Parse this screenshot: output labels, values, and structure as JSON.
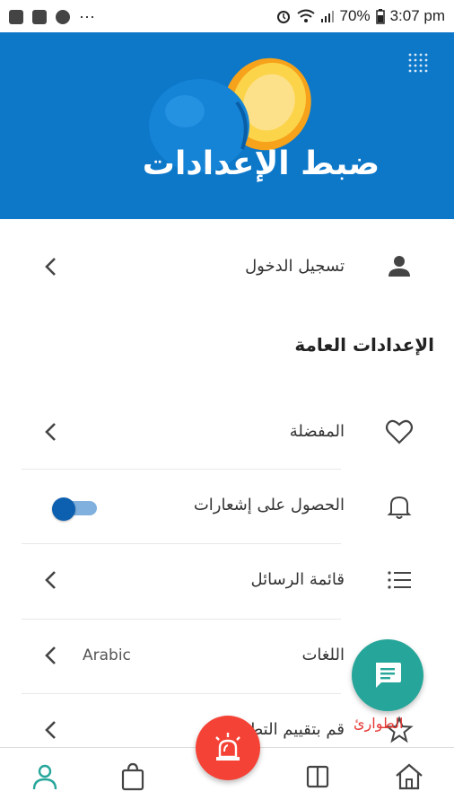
{
  "status_bar": {
    "battery": "70%",
    "time": "3:07 pm",
    "notif_dots": "···"
  },
  "header": {
    "title": "ضبط الإعدادات"
  },
  "login_row": {
    "label": "تسجيل الدخول"
  },
  "general_settings": {
    "title": "الإعدادات العامة",
    "items": [
      {
        "label": "المفضلة"
      },
      {
        "label": "الحصول على إشعارات",
        "toggle_on": true
      },
      {
        "label": "قائمة الرسائل"
      },
      {
        "label": "اللغات",
        "value": "Arabic"
      },
      {
        "label": "قم بتقييم التطبيق"
      }
    ]
  },
  "emergency_label": "الطوارئ",
  "colors": {
    "hero_blue": "#0d77c8",
    "teal": "#26a69a",
    "red": "#f44336",
    "toggle_blue": "#0d5fb0"
  },
  "icons": {
    "login": "person-icon",
    "favorites": "heart-icon",
    "notifications": "bell-icon",
    "messages": "list-icon",
    "chat_fab": "chat-icon",
    "emergency_fab": "siren-icon"
  }
}
